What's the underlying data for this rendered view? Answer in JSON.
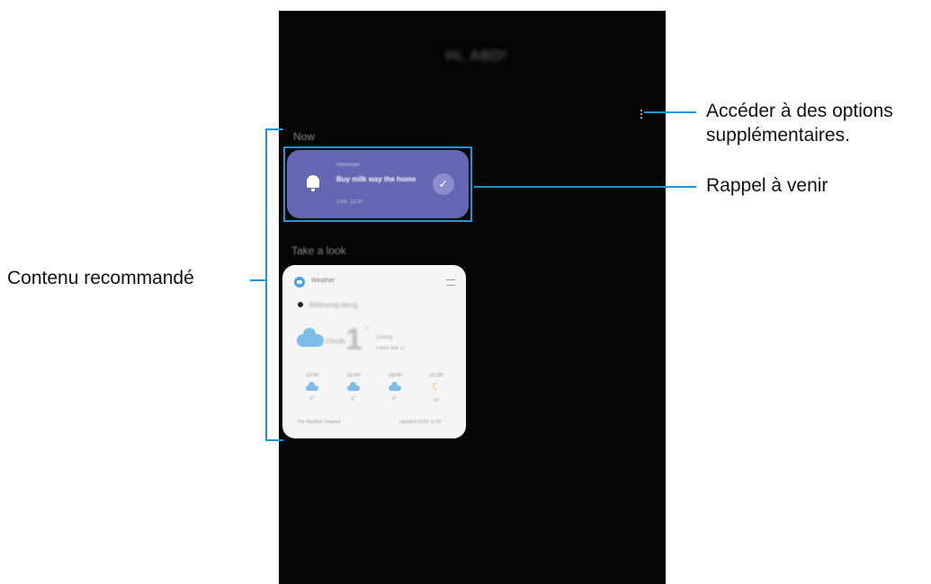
{
  "screen": {
    "greeting": "Hi, ABD!",
    "sections": {
      "now": "Now",
      "take_a_look": "Take a look"
    },
    "reminder_card": {
      "category": "Reminder",
      "title": "Buy milk way the home",
      "time": "1:00, 12:37",
      "check_icon": "check-icon"
    },
    "weather_card": {
      "app_name": "Weather",
      "location": "Malmong-dong",
      "condition_label": "Cloudy",
      "temperature": "1",
      "degree_symbol": "°",
      "unit_condition": "Cloudy",
      "range": "Feels like 2°",
      "hourly": [
        {
          "time": "12:00",
          "icon": "cloud-icon",
          "temp": "1°"
        },
        {
          "time": "15:00",
          "icon": "cloud-icon",
          "temp": "1°"
        },
        {
          "time": "18:00",
          "icon": "cloud-icon",
          "temp": "0°"
        },
        {
          "time": "21:00",
          "icon": "moon-icon",
          "temp": "-0°"
        }
      ],
      "source": "The Weather Channel",
      "updated": "Updated 01/01 11:00"
    }
  },
  "callouts": {
    "more_options": "Accéder à des options\nsupplémentaires.",
    "more_options_line1": "Accéder à des options",
    "more_options_line2": "supplémentaires.",
    "upcoming_reminder": "Rappel à venir",
    "recommended_content": "Contenu recommandé"
  },
  "colors": {
    "callout_line": "#1d97d4",
    "reminder_card": "#6466b3",
    "screen_background": "#050505"
  }
}
